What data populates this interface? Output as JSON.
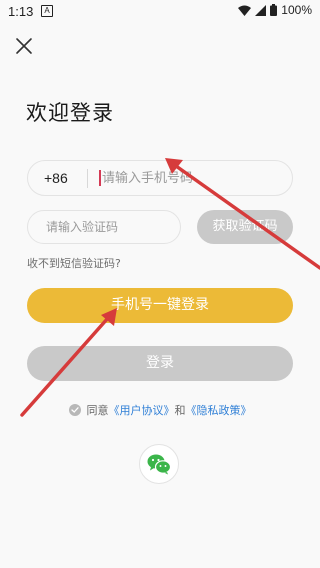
{
  "status_bar": {
    "time": "1:13",
    "notification_icon_letter": "A",
    "battery": "100%",
    "icons": [
      "a-notification-icon",
      "wifi-icon",
      "signal-icon",
      "battery-icon"
    ]
  },
  "header": {
    "close_icon": "close-icon",
    "title": "欢迎登录"
  },
  "phone_field": {
    "country_code": "+86",
    "placeholder": "请输入手机号码",
    "value": ""
  },
  "code_field": {
    "placeholder": "请输入验证码",
    "value": ""
  },
  "get_code_button": {
    "label": "获取验证码"
  },
  "no_code_link": {
    "label": "收不到短信验证码?"
  },
  "one_click_login_button": {
    "label": "手机号一键登录"
  },
  "login_button": {
    "label": "登录"
  },
  "agreement": {
    "prefix": "同意",
    "user_agreement": "《用户协议》",
    "connector": "和",
    "privacy_policy": "《隐私政策》"
  },
  "third_party": {
    "wechat_icon": "wechat-icon"
  },
  "colors": {
    "background": "#f9f9f9",
    "primary_yellow": "#ecba37",
    "disabled_gray": "#c9c9c9",
    "link_blue": "#2f7fd6",
    "wechat_green": "#3bb54a",
    "annotation_red": "#d63b3b"
  }
}
